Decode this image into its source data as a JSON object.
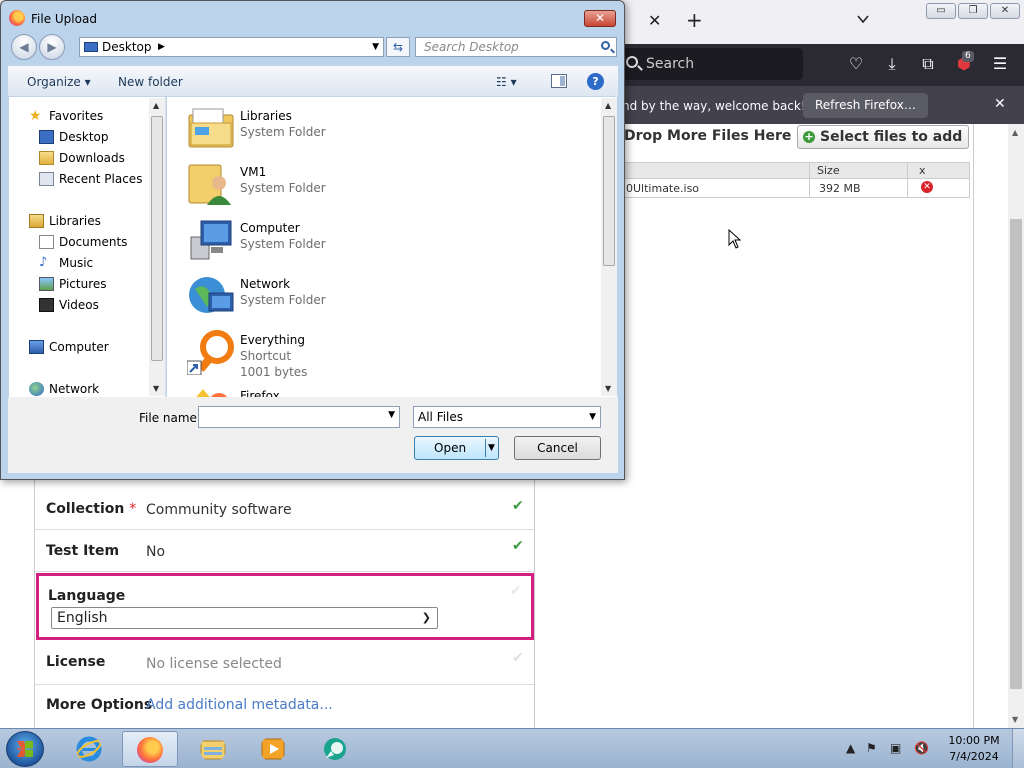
{
  "browser": {
    "search_placeholder": "Search",
    "notification_badge": "6",
    "notice_message": "nd by the way, welcome back!",
    "notice_button": "Refresh Firefox…"
  },
  "upload": {
    "drop_text": "Drop More Files Here or",
    "select_files_label": "Select files to add",
    "table_headers": [
      "",
      "Size",
      "x"
    ],
    "file": {
      "name": "0Ultimate.iso",
      "size": "392 MB"
    }
  },
  "form": {
    "collection_label": "Collection",
    "collection_required": "*",
    "collection_value": "Community software",
    "test_item_label": "Test Item",
    "test_item_value": "No",
    "language_label": "Language",
    "language_value": "English",
    "license_label": "License",
    "license_value": "No license selected",
    "more_options_label": "More Options",
    "more_options_link": "Add additional metadata..."
  },
  "dialog": {
    "title": "File Upload",
    "location": "Desktop",
    "search_placeholder": "Search Desktop",
    "toolbar": {
      "organize": "Organize ▾",
      "new_folder": "New folder"
    },
    "nav": {
      "favorites": "Favorites",
      "desktop": "Desktop",
      "downloads": "Downloads",
      "recent_places": "Recent Places",
      "libraries": "Libraries",
      "documents": "Documents",
      "music": "Music",
      "pictures": "Pictures",
      "videos": "Videos",
      "computer": "Computer",
      "network": "Network"
    },
    "files": [
      {
        "name": "Libraries",
        "type": "System Folder"
      },
      {
        "name": "VM1",
        "type": "System Folder"
      },
      {
        "name": "Computer",
        "type": "System Folder"
      },
      {
        "name": "Network",
        "type": "System Folder"
      },
      {
        "name": "Everything",
        "type": "Shortcut",
        "size": "1001 bytes"
      },
      {
        "name": "Firefox",
        "type": ""
      }
    ],
    "file_name_label": "File name:",
    "file_name_value": "",
    "file_type_value": "All Files",
    "open_button": "Open",
    "cancel_button": "Cancel"
  },
  "taskbar": {
    "time": "10:00 PM",
    "date": "7/4/2024"
  },
  "colors": {
    "highlight_border": "#d31f7e",
    "check_green": "#3b9a45",
    "link_blue": "#4a7cc7"
  }
}
